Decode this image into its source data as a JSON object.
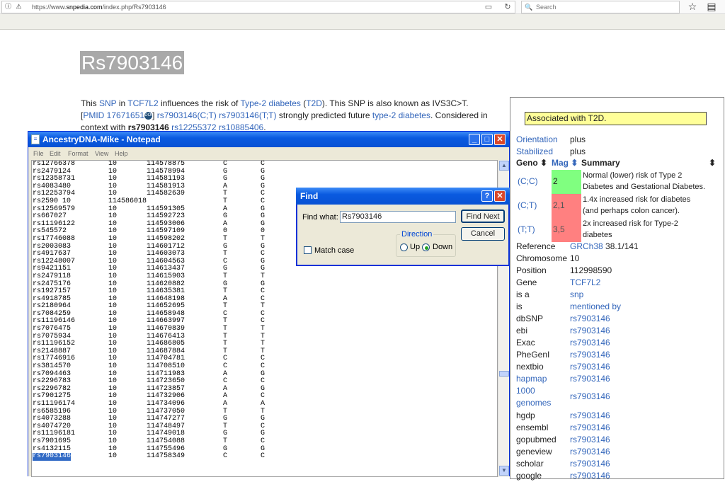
{
  "browser": {
    "url_prefix": "https://www.",
    "url_domain": "snpedia.com",
    "url_path": "/index.php/Rs7903146",
    "search_placeholder": "Search"
  },
  "page": {
    "title": "Rs7903146",
    "intro": {
      "t1": "This ",
      "snp": "SNP",
      "t2": " in ",
      "gene": "TCF7L2",
      "t3": " influences the risk of ",
      "disease": "Type-2 diabetes",
      "t4": " (",
      "abbr": "T2D",
      "t5": "). This SNP is also known as IVS3C>T.",
      "br1": "[",
      "pmid": "PMID 17671651",
      "doi": "DOI",
      "br2": "] ",
      "ct": "rs7903146(C;T)",
      "sp": " ",
      "tt": "rs7903146(T;T)",
      "t6": " strongly predicted future ",
      "disease2": "type-2 diabetes",
      "t7": ". Considered in",
      "t8": "context with ",
      "bold": "rs7903146",
      "sp2": " ",
      "rs1": "rs12255372",
      "sp3": " ",
      "rs2": "rs10885406",
      "t9": "."
    }
  },
  "infobox": {
    "associated": "Associated with T2D.",
    "orientation": {
      "k": "Orientation",
      "v": "plus"
    },
    "stabilized": {
      "k": "Stabilized",
      "v": "plus"
    },
    "headers": {
      "geno": "Geno",
      "mag": "Mag",
      "summary": "Summary",
      "sort": "⬍"
    },
    "genotypes": [
      {
        "geno": "(C;C)",
        "mag": "2",
        "summary1": "Normal (lower) risk of Type 2",
        "summary2": "Diabetes and Gestational Diabetes."
      },
      {
        "geno": "(C;T)",
        "mag": "2,1",
        "summary1": "1.4x increased risk for diabetes",
        "summary2": "(and perhaps colon cancer)."
      },
      {
        "geno": "(T;T)",
        "mag": "3,5",
        "summary1": "2x increased risk for Type-2",
        "summary2": "diabetes"
      }
    ],
    "reference": {
      "k": "Reference",
      "v1": "GRCh38",
      "v2": " 38.1/141"
    },
    "chromosome": {
      "k": "Chromosome",
      "v": "10"
    },
    "position": {
      "k": "Position",
      "v": "112998590"
    },
    "gene": {
      "k": "Gene",
      "v": "TCF7L2"
    },
    "isa": {
      "k": "is a",
      "v": "snp"
    },
    "is": {
      "k": "is",
      "v": "mentioned by"
    },
    "links": [
      {
        "k": "dbSNP",
        "v": "rs7903146"
      },
      {
        "k": "ebi",
        "v": "rs7903146"
      },
      {
        "k": "Exac",
        "v": "rs7903146"
      },
      {
        "k": "PheGenI",
        "v": "rs7903146"
      },
      {
        "k": "nextbio",
        "v": "rs7903146"
      },
      {
        "k": "hapmap",
        "v": "rs7903146"
      }
    ],
    "genomes": {
      "k1": "1000",
      "k2": "genomes",
      "v": "rs7903146"
    },
    "links2": [
      {
        "k": "hgdp",
        "v": "rs7903146"
      },
      {
        "k": "ensembl",
        "v": "rs7903146"
      },
      {
        "k": "gopubmed",
        "v": "rs7903146"
      },
      {
        "k": "geneview",
        "v": "rs7903146"
      },
      {
        "k": "scholar",
        "v": "rs7903146"
      },
      {
        "k": "google",
        "v": "rs7903146"
      }
    ]
  },
  "notepad": {
    "title": "AncestryDNA-Mike - Notepad",
    "menu": [
      "File",
      "Edit",
      "Format",
      "View",
      "Help"
    ],
    "rows": [
      [
        "rs12766378",
        "10",
        "114578875",
        "C",
        "C"
      ],
      [
        "rs2479124",
        "10",
        "114578994",
        "G",
        "G"
      ],
      [
        "rs12358731",
        "10",
        "114581193",
        "G",
        "G"
      ],
      [
        "rs4083480",
        "10",
        "114581913",
        "A",
        "G"
      ],
      [
        "rs12253794",
        "10",
        "114582639",
        "T",
        "C"
      ],
      [
        "rs2590  10",
        "114586018",
        "",
        "T",
        "C"
      ],
      [
        "rs12569579",
        "10",
        "114591305",
        "A",
        "G"
      ],
      [
        "rs667027",
        "10",
        "114592723",
        "G",
        "G"
      ],
      [
        "rs11196122",
        "10",
        "114593006",
        "A",
        "G"
      ],
      [
        "rs545572",
        "10",
        "114597109",
        "0",
        "0"
      ],
      [
        "rs17746088",
        "10",
        "114598202",
        "T",
        "T"
      ],
      [
        "rs2003083",
        "10",
        "114601712",
        "G",
        "G"
      ],
      [
        "rs4917637",
        "10",
        "114603073",
        "T",
        "C"
      ],
      [
        "rs12248007",
        "10",
        "114604563",
        "C",
        "G"
      ],
      [
        "rs9421151",
        "10",
        "114613437",
        "G",
        "G"
      ],
      [
        "rs2479118",
        "10",
        "114615903",
        "T",
        "T"
      ],
      [
        "rs2475176",
        "10",
        "114620882",
        "G",
        "G"
      ],
      [
        "rs1927157",
        "10",
        "114635381",
        "T",
        "C"
      ],
      [
        "rs4918785",
        "10",
        "114648198",
        "A",
        "C"
      ],
      [
        "rs2180964",
        "10",
        "114652695",
        "T",
        "T"
      ],
      [
        "rs7084259",
        "10",
        "114658948",
        "C",
        "C"
      ],
      [
        "rs11196146",
        "10",
        "114663997",
        "T",
        "C"
      ],
      [
        "rs7076475",
        "10",
        "114670839",
        "T",
        "T"
      ],
      [
        "rs7075934",
        "10",
        "114676413",
        "T",
        "T"
      ],
      [
        "rs11196152",
        "10",
        "114686805",
        "T",
        "T"
      ],
      [
        "rs2148887",
        "10",
        "114687884",
        "T",
        "T"
      ],
      [
        "rs17746916",
        "10",
        "114704781",
        "C",
        "C"
      ],
      [
        "rs3814570",
        "10",
        "114708510",
        "C",
        "C"
      ],
      [
        "rs7094463",
        "10",
        "114711983",
        "A",
        "G"
      ],
      [
        "rs2296783",
        "10",
        "114723650",
        "C",
        "C"
      ],
      [
        "rs2296782",
        "10",
        "114723857",
        "A",
        "G"
      ],
      [
        "rs7901275",
        "10",
        "114732906",
        "A",
        "C"
      ],
      [
        "rs11196174",
        "10",
        "114734096",
        "A",
        "A"
      ],
      [
        "rs6585196",
        "10",
        "114737050",
        "T",
        "T"
      ],
      [
        "rs4073288",
        "10",
        "114747277",
        "G",
        "G"
      ],
      [
        "rs4074720",
        "10",
        "114748497",
        "T",
        "C"
      ],
      [
        "rs11196181",
        "10",
        "114749018",
        "G",
        "G"
      ],
      [
        "rs7901695",
        "10",
        "114754088",
        "T",
        "C"
      ],
      [
        "rs4132115",
        "10",
        "114755496",
        "G",
        "G"
      ],
      [
        "rs7903146",
        "10",
        "114758349",
        "C",
        "C"
      ]
    ]
  },
  "find": {
    "title": "Find",
    "find_what_label": "Find what:",
    "find_what_value": "Rs7903146",
    "find_next": "Find Next",
    "cancel": "Cancel",
    "direction_label": "Direction",
    "up": "Up",
    "down": "Down",
    "match_case": "Match case",
    "help": "?",
    "close": "✕"
  },
  "icons": {
    "info": "ⓘ",
    "warn": "⚠",
    "reader": "▭",
    "reload": "↻",
    "search": "🔍",
    "star": "☆",
    "bookmarks": "▤"
  }
}
